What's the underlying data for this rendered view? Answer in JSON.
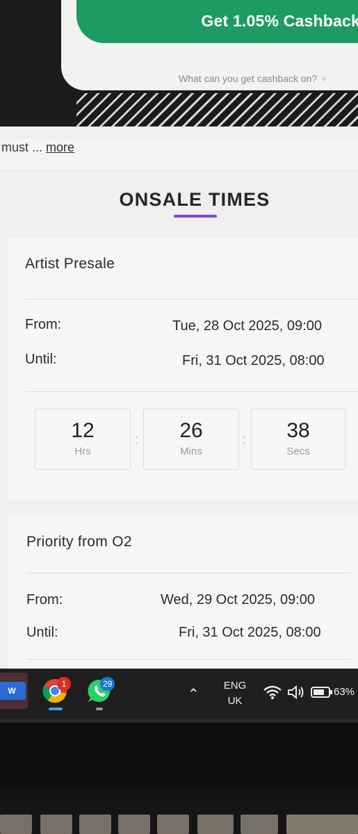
{
  "cashback": {
    "button_label": "Get 1.05% Cashback",
    "link_label": "What can you get cashback on?",
    "link_plus": "+"
  },
  "description": {
    "truncated_text": "must ... ",
    "more_label": "more"
  },
  "onsale": {
    "section_title": "ONSALE TIMES",
    "accent_color": "#7b49d3",
    "presales": [
      {
        "name": "Artist Presale",
        "from_label": "From:",
        "from_value": "Tue, 28 Oct 2025, 09:00",
        "until_label": "Until:",
        "until_value": "Fri, 31 Oct 2025, 08:00",
        "countdown": {
          "hours": "12",
          "hours_unit": "Hrs",
          "minutes": "26",
          "minutes_unit": "Mins",
          "seconds": "38",
          "seconds_unit": "Secs",
          "separator": ":"
        }
      },
      {
        "name": "Priority from O2",
        "from_label": "From:",
        "from_value": "Wed, 29 Oct 2025, 09:00",
        "until_label": "Until:",
        "until_value": "Fri, 31 Oct 2025, 08:00"
      }
    ]
  },
  "taskbar": {
    "apps": [
      {
        "name": "word",
        "icon": "word-icon",
        "glyph": "W"
      },
      {
        "name": "chrome",
        "icon": "chrome-icon",
        "badge": "1",
        "badge_color": "#d93025"
      },
      {
        "name": "whatsapp",
        "icon": "whatsapp-icon",
        "badge": "29",
        "badge_color": "#1976d2"
      }
    ],
    "tray": {
      "chevron_icon": "chevron-up-icon",
      "language_line1": "ENG",
      "language_line2": "UK",
      "wifi_icon": "wifi-icon",
      "volume_icon": "volume-icon",
      "battery_icon": "battery-icon",
      "battery_percent": "63%"
    }
  }
}
